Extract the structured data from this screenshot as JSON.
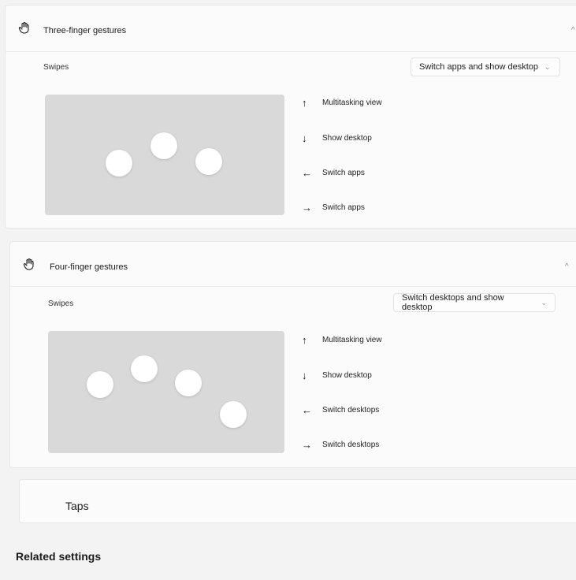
{
  "three_finger": {
    "title": "Three-finger gestures",
    "icon": "hand-icon",
    "chevron": "^",
    "swipes_label": "Swipes",
    "dropdown_value": "Switch apps and show desktop",
    "dropdown_chevron": "⌄",
    "gestures": [
      {
        "arrow": "↑",
        "label": "Multitasking view"
      },
      {
        "arrow": "↓",
        "label": "Show desktop"
      },
      {
        "arrow": "←",
        "label": "Switch apps"
      },
      {
        "arrow": "→",
        "label": "Switch apps"
      }
    ]
  },
  "four_finger": {
    "title": "Four-finger gestures",
    "icon": "hand-icon",
    "chevron": "^",
    "swipes_label": "Swipes",
    "dropdown_value": "Switch desktops and show desktop",
    "dropdown_chevron": "⌄",
    "gestures": [
      {
        "arrow": "↑",
        "label": "Multitasking view"
      },
      {
        "arrow": "↓",
        "label": "Show desktop"
      },
      {
        "arrow": "←",
        "label": "Switch desktops"
      },
      {
        "arrow": "→",
        "label": "Switch desktops"
      }
    ]
  },
  "taps": {
    "label": "Taps"
  },
  "related": {
    "label": "Related settings"
  }
}
